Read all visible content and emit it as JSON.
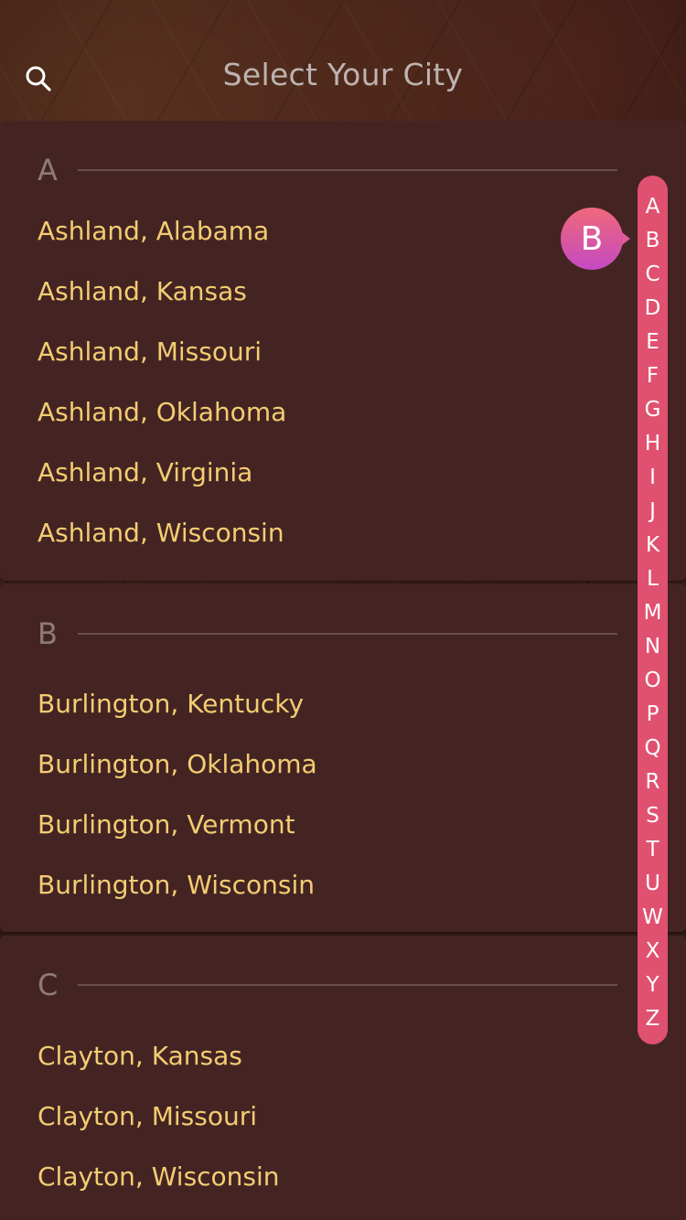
{
  "header": {
    "title": "Select Your City",
    "search_icon": "search-icon"
  },
  "sections": [
    {
      "letter": "A",
      "cities": [
        "Ashland, Alabama",
        "Ashland, Kansas",
        "Ashland, Missouri",
        "Ashland, Oklahoma",
        "Ashland, Virginia",
        "Ashland, Wisconsin"
      ]
    },
    {
      "letter": "B",
      "cities": [
        "Burlington, Kentucky",
        "Burlington, Oklahoma",
        "Burlington, Vermont",
        "Burlington, Wisconsin"
      ]
    },
    {
      "letter": "C",
      "cities": [
        "Clayton, Kansas",
        "Clayton, Missouri",
        "Clayton, Wisconsin"
      ]
    }
  ],
  "index": {
    "letters": [
      "A",
      "B",
      "C",
      "D",
      "E",
      "F",
      "G",
      "H",
      "I",
      "J",
      "K",
      "L",
      "M",
      "N",
      "O",
      "P",
      "Q",
      "R",
      "S",
      "T",
      "U",
      "W",
      "X",
      "Y",
      "Z"
    ],
    "active_letter": "B"
  },
  "colors": {
    "city_text": "#f3cd72",
    "section_bg": "#442423",
    "index_bg": "#e05170",
    "bubble_gradient_top": "#f0687a",
    "bubble_gradient_bottom": "#c44ac3"
  }
}
